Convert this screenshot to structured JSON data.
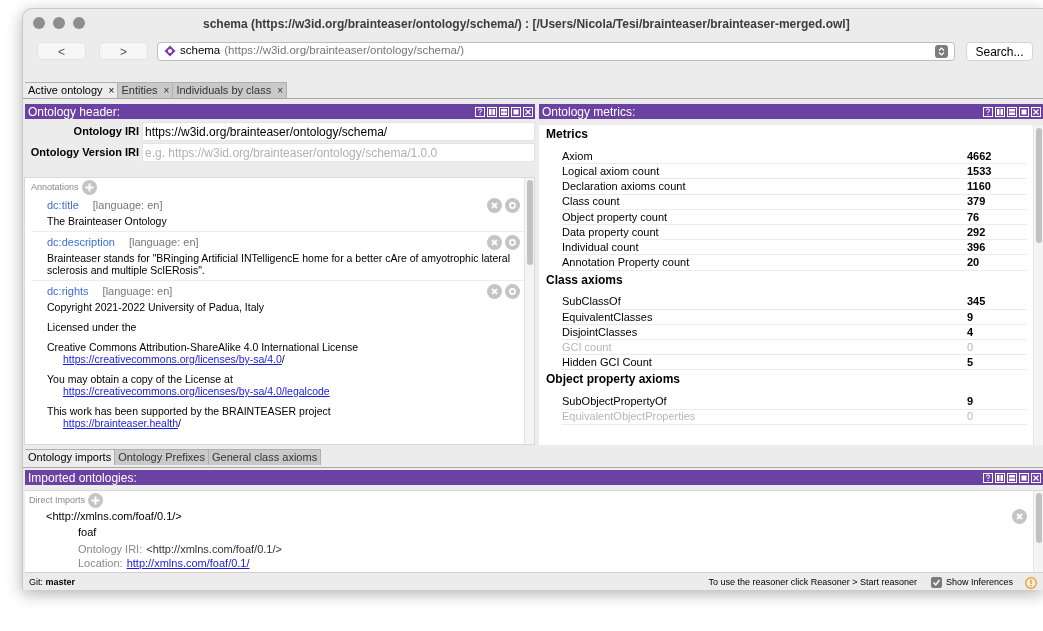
{
  "window": {
    "title": "schema (https://w3id.org/brainteaser/ontology/schema/)  : [/Users/Nicola/Tesi/brainteaser/brainteaser-merged.owl]"
  },
  "toolbar": {
    "back": "<",
    "forward": ">",
    "address_name": "schema",
    "address_iri": "(https://w3id.org/brainteaser/ontology/schema/)",
    "search": "Search..."
  },
  "tabs": [
    {
      "label": "Active ontology",
      "close": "×",
      "selected": true
    },
    {
      "label": "Entities",
      "close": "×",
      "selected": false
    },
    {
      "label": "Individuals by class",
      "close": "×",
      "selected": false
    }
  ],
  "ontology_header": {
    "title": "Ontology header:",
    "fields": [
      {
        "label": "Ontology IRI",
        "value": "https://w3id.org/brainteaser/ontology/schema/"
      },
      {
        "label": "Ontology Version IRI",
        "placeholder": "e.g. https://w3id.org/brainteaser/ontology/schema/1.0.0"
      }
    ],
    "annotations_label": "Annotations",
    "annotations": [
      {
        "property": "dc:title",
        "language": "[language: en]",
        "paragraphs": [
          {
            "text": "The Brainteaser Ontology"
          }
        ]
      },
      {
        "property": "dc:description",
        "language": "[language: en]",
        "paragraphs": [
          {
            "text": "Brainteaser stands for \"BRinging Artificial INTelligencE home for a better cAre of amyotrophic lateral sclerosis and multiple SclERosis\"."
          }
        ]
      },
      {
        "property": "dc:rights",
        "language": "[language: en]",
        "paragraphs": [
          {
            "text": "Copyright 2021-2022 University of Padua, Italy"
          },
          {
            "text": "Licensed under the"
          },
          {
            "text": "Creative Commons Attribution-ShareAlike 4.0 International License",
            "link": "https://creativecommons.org/licenses/by-sa/4.0",
            "link_suffix": "/"
          },
          {
            "text": "You may obtain a copy of the License at",
            "link": "https://creativecommons.org/licenses/by-sa/4.0/legalcode"
          },
          {
            "text": "This work has been supported by the BRAINTEASER project",
            "link": "https://brainteaser.health",
            "link_suffix": "/"
          }
        ]
      }
    ]
  },
  "ontology_metrics": {
    "title": "Ontology metrics:",
    "sections": [
      {
        "title": "Metrics",
        "rows": [
          {
            "label": "Axiom",
            "value": "4662",
            "disabled": false
          },
          {
            "label": "Logical axiom count",
            "value": "1533",
            "disabled": false
          },
          {
            "label": "Declaration axioms count",
            "value": "1160",
            "disabled": false
          },
          {
            "label": "Class count",
            "value": "379",
            "disabled": false
          },
          {
            "label": "Object property count",
            "value": "76",
            "disabled": false
          },
          {
            "label": "Data property count",
            "value": "292",
            "disabled": false
          },
          {
            "label": "Individual count",
            "value": "396",
            "disabled": false
          },
          {
            "label": "Annotation Property count",
            "value": "20",
            "disabled": false
          }
        ]
      },
      {
        "title": "Class axioms",
        "rows": [
          {
            "label": "SubClassOf",
            "value": "345",
            "disabled": false
          },
          {
            "label": "EquivalentClasses",
            "value": "9",
            "disabled": false
          },
          {
            "label": "DisjointClasses",
            "value": "4",
            "disabled": false
          },
          {
            "label": "GCI count",
            "value": "0",
            "disabled": true
          },
          {
            "label": "Hidden GCI Count",
            "value": "5",
            "disabled": false
          }
        ]
      },
      {
        "title": "Object property axioms",
        "rows": [
          {
            "label": "SubObjectPropertyOf",
            "value": "9",
            "disabled": false
          },
          {
            "label": "EquivalentObjectProperties",
            "value": "0",
            "disabled": true
          }
        ]
      }
    ]
  },
  "bottom_tabs": [
    {
      "label": "Ontology imports",
      "selected": true
    },
    {
      "label": "Ontology Prefixes",
      "selected": false
    },
    {
      "label": "General class axioms",
      "selected": false
    }
  ],
  "imported_ontologies": {
    "title": "Imported ontologies:",
    "direct_imports_label": "Direct Imports",
    "imports": [
      {
        "iri": "<http://xmlns.com/foaf/0.1/>",
        "name": "foaf",
        "ontology_iri_label": "Ontology IRI:",
        "ontology_iri": "<http://xmlns.com/foaf/0.1/>",
        "location_label": "Location:",
        "location": "http://xmlns.com/foaf/0.1/"
      }
    ]
  },
  "status_bar": {
    "git": "Git: **master**",
    "reasoner_hint": "To use the reasoner click Reasoner > Start reasoner",
    "show_inferences": {
      "label": "Show Inferences",
      "checked": true
    }
  }
}
